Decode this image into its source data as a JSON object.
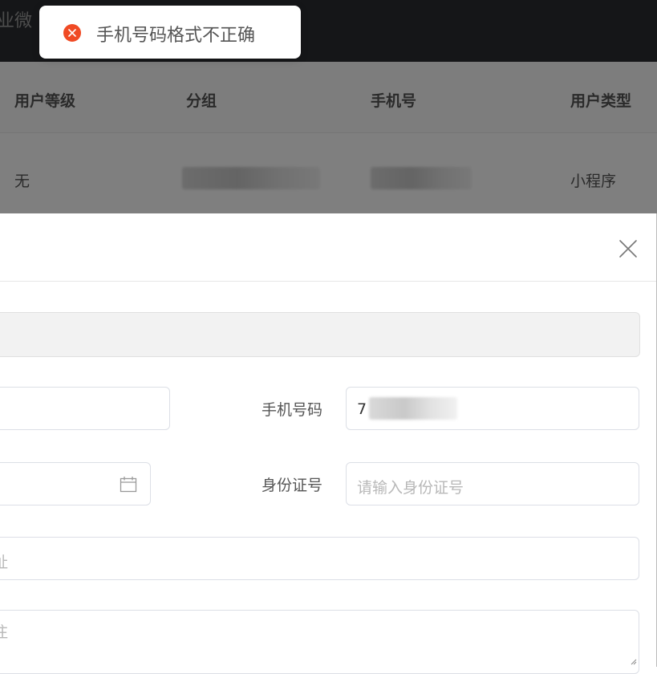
{
  "topbar": {
    "title": "业微"
  },
  "table": {
    "headers": [
      "用户等级",
      "分组",
      "手机号",
      "用户类型"
    ],
    "row": {
      "level": "无",
      "user_type": "小程序"
    }
  },
  "toast": {
    "message": "手机号码格式不正确",
    "icon": "error-circle-icon",
    "color": "#f04a24"
  },
  "dialog": {
    "close_icon": "close-icon",
    "phone": {
      "label": "手机号码",
      "value": "7"
    },
    "id_card": {
      "label": "身份证号",
      "placeholder": "请输入身份证号"
    },
    "address_placeholder_fragment": "址",
    "remark_placeholder_fragment": "注"
  }
}
